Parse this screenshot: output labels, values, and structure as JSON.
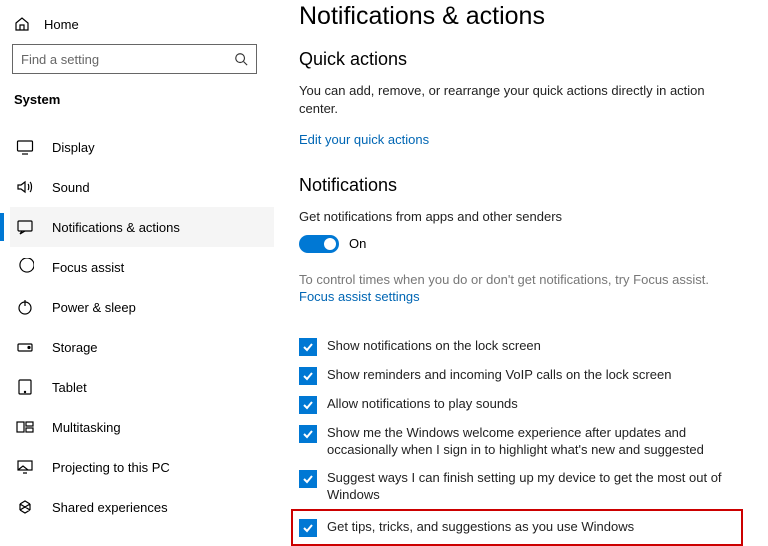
{
  "sidebar": {
    "home": "Home",
    "search_placeholder": "Find a setting",
    "category": "System",
    "items": [
      {
        "label": "Display"
      },
      {
        "label": "Sound"
      },
      {
        "label": "Notifications & actions"
      },
      {
        "label": "Focus assist"
      },
      {
        "label": "Power & sleep"
      },
      {
        "label": "Storage"
      },
      {
        "label": "Tablet"
      },
      {
        "label": "Multitasking"
      },
      {
        "label": "Projecting to this PC"
      },
      {
        "label": "Shared experiences"
      }
    ]
  },
  "main": {
    "title": "Notifications & actions",
    "quick_actions": {
      "heading": "Quick actions",
      "desc": "You can add, remove, or rearrange your quick actions directly in action center.",
      "link": "Edit your quick actions"
    },
    "notifications": {
      "heading": "Notifications",
      "toggle_label": "Get notifications from apps and other senders",
      "toggle_value": "On",
      "focus_hint": "To control times when you do or don't get notifications, try Focus assist.",
      "focus_link": "Focus assist settings",
      "checks": [
        "Show notifications on the lock screen",
        "Show reminders and incoming VoIP calls on the lock screen",
        "Allow notifications to play sounds",
        "Show me the Windows welcome experience after updates and occasionally when I sign in to highlight what's new and suggested",
        "Suggest ways I can finish setting up my device to get the most out of Windows",
        "Get tips, tricks, and suggestions as you use Windows"
      ]
    }
  }
}
